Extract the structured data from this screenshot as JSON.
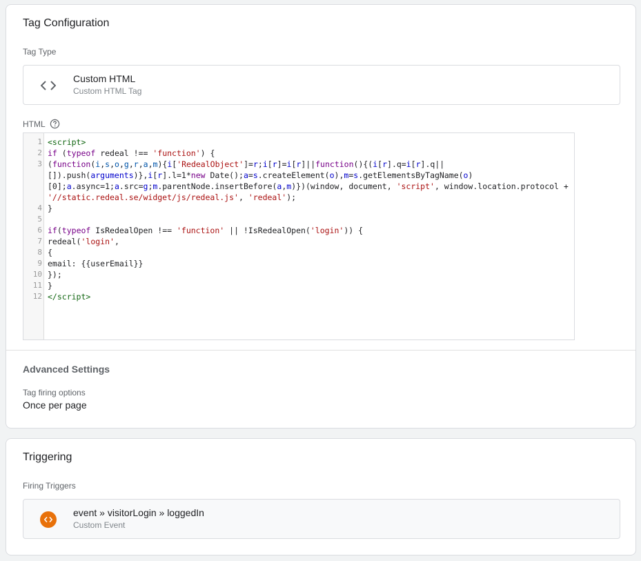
{
  "tag_configuration": {
    "title": "Tag Configuration",
    "tag_type_label": "Tag Type",
    "tag_type": {
      "name": "Custom HTML",
      "subtitle": "Custom HTML Tag",
      "icon": "code-brackets-icon"
    },
    "html_label": "HTML",
    "help_icon": "help-circle-icon",
    "code_lines": [
      {
        "n": "1",
        "html": "<span class=\"tok-tag\">&lt;script&gt;</span>"
      },
      {
        "n": "2",
        "html": "<span class=\"tok-kw\">if</span> (<span class=\"tok-kw\">typeof</span> redeal !== <span class=\"tok-str\">'function'</span>) {"
      },
      {
        "n": "3",
        "html": "(<span class=\"tok-kw\">function</span>(<span class=\"tok-def\">i</span>,<span class=\"tok-def\">s</span>,<span class=\"tok-def\">o</span>,<span class=\"tok-def\">g</span>,<span class=\"tok-def\">r</span>,<span class=\"tok-def\">a</span>,<span class=\"tok-def\">m</span>){<span class=\"tok-var\">i</span>[<span class=\"tok-str\">'RedealObject'</span>]=<span class=\"tok-var\">r</span>;<span class=\"tok-var\">i</span>[<span class=\"tok-var\">r</span>]=<span class=\"tok-var\">i</span>[<span class=\"tok-var\">r</span>]||<span class=\"tok-kw\">function</span>(){(<span class=\"tok-var\">i</span>[<span class=\"tok-var\">r</span>].q=<span class=\"tok-var\">i</span>[<span class=\"tok-var\">r</span>].q||"
      },
      {
        "n": "",
        "html": "[]).push(<span class=\"tok-var\">arguments</span>)},<span class=\"tok-var\">i</span>[<span class=\"tok-var\">r</span>].l=1*<span class=\"tok-kw\">new</span> Date();<span class=\"tok-var\">a</span>=<span class=\"tok-var\">s</span>.createElement(<span class=\"tok-var\">o</span>),<span class=\"tok-var\">m</span>=<span class=\"tok-var\">s</span>.getElementsByTagName(<span class=\"tok-var\">o</span>)"
      },
      {
        "n": "",
        "html": "[0];<span class=\"tok-var\">a</span>.async=1;<span class=\"tok-var\">a</span>.src=<span class=\"tok-var\">g</span>;<span class=\"tok-var\">m</span>.parentNode.insertBefore(<span class=\"tok-var\">a</span>,<span class=\"tok-var\">m</span>)})(window, document, <span class=\"tok-str\">'script'</span>, window.location.protocol +"
      },
      {
        "n": "",
        "html": "<span class=\"tok-str\">'//static.redeal.se/widget/js/redeal.js'</span>, <span class=\"tok-str\">'redeal'</span>);"
      },
      {
        "n": "4",
        "html": "}"
      },
      {
        "n": "5",
        "html": ""
      },
      {
        "n": "6",
        "html": "<span class=\"tok-kw\">if</span>(<span class=\"tok-kw\">typeof</span> IsRedealOpen !== <span class=\"tok-str\">'function'</span> || !IsRedealOpen(<span class=\"tok-str\">'login'</span>)) {"
      },
      {
        "n": "7",
        "html": "redeal(<span class=\"tok-str\">'login'</span>,"
      },
      {
        "n": "8",
        "html": "{"
      },
      {
        "n": "9",
        "html": "email: {{userEmail}}"
      },
      {
        "n": "10",
        "html": "});"
      },
      {
        "n": "11",
        "html": "}"
      },
      {
        "n": "12",
        "html": "<span class=\"tok-tag\">&lt;/script&gt;</span>"
      }
    ],
    "advanced_settings_title": "Advanced Settings",
    "firing_options_label": "Tag firing options",
    "firing_options_value": "Once per page"
  },
  "triggering": {
    "title": "Triggering",
    "firing_triggers_label": "Firing Triggers",
    "trigger": {
      "name": "event » visitorLogin » loggedIn",
      "subtitle": "Custom Event",
      "icon": "custom-event-icon",
      "icon_color": "#e8710a"
    }
  }
}
